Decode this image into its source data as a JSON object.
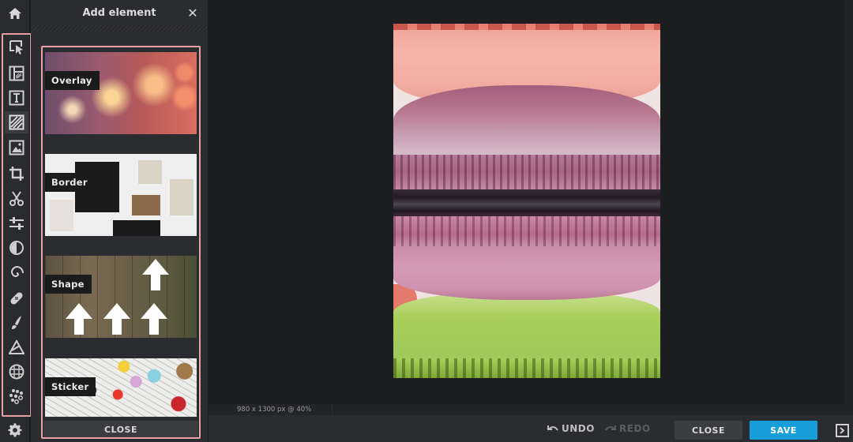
{
  "rail": {
    "home_icon": "home-icon",
    "tools": [
      {
        "name": "select-tool",
        "icon": "cursor-select-icon",
        "active": false
      },
      {
        "name": "layout-tool",
        "icon": "layout-icon",
        "active": false
      },
      {
        "name": "text-tool",
        "icon": "text-icon",
        "active": false
      },
      {
        "name": "overlay-tool",
        "icon": "hatch-overlay-icon",
        "active": true
      },
      {
        "name": "image-tool",
        "icon": "image-icon",
        "active": false
      },
      {
        "name": "crop-tool",
        "icon": "crop-icon",
        "active": false
      },
      {
        "name": "cut-tool",
        "icon": "scissors-icon",
        "active": false
      },
      {
        "name": "adjust-tool",
        "icon": "sliders-icon",
        "active": false
      },
      {
        "name": "contrast-tool",
        "icon": "contrast-icon",
        "active": false
      },
      {
        "name": "swirl-tool",
        "icon": "swirl-icon",
        "active": false
      },
      {
        "name": "heal-tool",
        "icon": "bandage-icon",
        "active": false
      },
      {
        "name": "brush-tool",
        "icon": "brush-icon",
        "active": false
      },
      {
        "name": "draw-tool",
        "icon": "triangle-draw-icon",
        "active": false
      },
      {
        "name": "pattern-tool",
        "icon": "grid-circle-icon",
        "active": false
      },
      {
        "name": "effects-tool",
        "icon": "bubbles-icon",
        "active": false
      }
    ],
    "settings_icon": "gear-icon"
  },
  "panel": {
    "title": "Add element",
    "close_icon": "close-icon",
    "cards": [
      {
        "label": "Overlay"
      },
      {
        "label": "Border"
      },
      {
        "label": "Shape"
      },
      {
        "label": "Sticker"
      }
    ],
    "close_button": "CLOSE"
  },
  "canvas": {
    "image_description": "Stacked macarons: pink, purple, green",
    "status": "980 x 1300 px @ 40%"
  },
  "bottombar": {
    "undo": "UNDO",
    "redo": "REDO",
    "close": "CLOSE",
    "save": "SAVE",
    "expand_icon": "expand-panel-icon"
  },
  "colors": {
    "highlight_border": "#e8a0a6",
    "save_blue": "#1a9ddb",
    "background": "#1c1d1f",
    "panel": "#2b2c2f"
  }
}
